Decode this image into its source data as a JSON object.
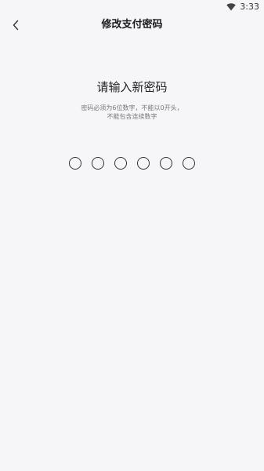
{
  "status_bar": {
    "time": "3:33",
    "wifi_icon": "wifi-icon"
  },
  "nav": {
    "back_icon": "chevron-left-icon",
    "title": "修改支付密码"
  },
  "main": {
    "prompt_title": "请输入新密码",
    "hint_line1": "密码必须为6位数字，不能以0开头，",
    "hint_line2": "不能包含连续数字",
    "pin_length": 6,
    "pin_filled": 0
  },
  "colors": {
    "background": "#f6f6f8",
    "text": "#222222",
    "hint": "#777777"
  }
}
